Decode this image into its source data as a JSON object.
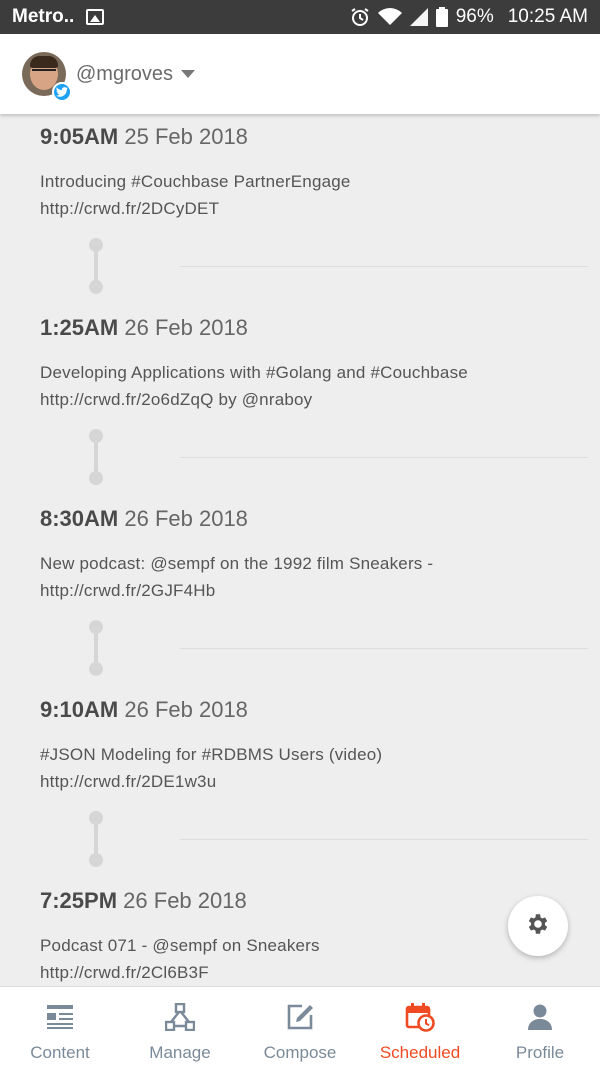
{
  "status_bar": {
    "carrier": "Metro..",
    "battery": "96%",
    "time": "10:25 AM"
  },
  "header": {
    "handle": "@mgroves"
  },
  "posts": [
    {
      "time": "9:05AM",
      "date": "25 Feb 2018",
      "line1": "Introducing #Couchbase PartnerEngage",
      "line2": "http://crwd.fr/2DCyDET"
    },
    {
      "time": "1:25AM",
      "date": "26 Feb 2018",
      "line1": "Developing Applications with #Golang and #Couchbase",
      "line2": "http://crwd.fr/2o6dZqQ by @nraboy"
    },
    {
      "time": "8:30AM",
      "date": "26 Feb 2018",
      "line1": "New podcast: @sempf on the 1992 film Sneakers -",
      "line2": "http://crwd.fr/2GJF4Hb"
    },
    {
      "time": "9:10AM",
      "date": "26 Feb 2018",
      "line1": "#JSON Modeling for #RDBMS Users (video)",
      "line2": "http://crwd.fr/2DE1w3u"
    },
    {
      "time": "7:25PM",
      "date": "26 Feb 2018",
      "line1": "Podcast 071 - @sempf on Sneakers",
      "line2": "http://crwd.fr/2Cl6B3F"
    }
  ],
  "bottom_nav": {
    "items": [
      {
        "label": "Content",
        "icon": "content-icon"
      },
      {
        "label": "Manage",
        "icon": "manage-icon"
      },
      {
        "label": "Compose",
        "icon": "compose-icon"
      },
      {
        "label": "Scheduled",
        "icon": "calendar-clock-icon"
      },
      {
        "label": "Profile",
        "icon": "profile-icon"
      }
    ],
    "active": "Scheduled"
  },
  "colors": {
    "accent": "#f04a23",
    "nav_inactive": "#7b8a99",
    "twitter": "#1da1f2",
    "status_bar": "#3c3c3c"
  }
}
